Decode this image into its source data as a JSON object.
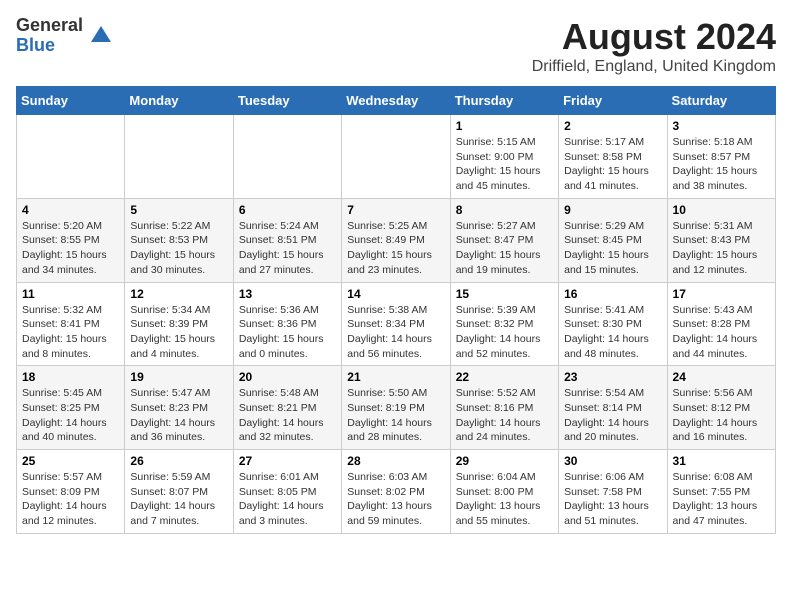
{
  "logo": {
    "general": "General",
    "blue": "Blue"
  },
  "title": {
    "month_year": "August 2024",
    "location": "Driffield, England, United Kingdom"
  },
  "weekdays": [
    "Sunday",
    "Monday",
    "Tuesday",
    "Wednesday",
    "Thursday",
    "Friday",
    "Saturday"
  ],
  "weeks": [
    [
      {
        "day": "",
        "content": ""
      },
      {
        "day": "",
        "content": ""
      },
      {
        "day": "",
        "content": ""
      },
      {
        "day": "",
        "content": ""
      },
      {
        "day": "1",
        "content": "Sunrise: 5:15 AM\nSunset: 9:00 PM\nDaylight: 15 hours\nand 45 minutes."
      },
      {
        "day": "2",
        "content": "Sunrise: 5:17 AM\nSunset: 8:58 PM\nDaylight: 15 hours\nand 41 minutes."
      },
      {
        "day": "3",
        "content": "Sunrise: 5:18 AM\nSunset: 8:57 PM\nDaylight: 15 hours\nand 38 minutes."
      }
    ],
    [
      {
        "day": "4",
        "content": "Sunrise: 5:20 AM\nSunset: 8:55 PM\nDaylight: 15 hours\nand 34 minutes."
      },
      {
        "day": "5",
        "content": "Sunrise: 5:22 AM\nSunset: 8:53 PM\nDaylight: 15 hours\nand 30 minutes."
      },
      {
        "day": "6",
        "content": "Sunrise: 5:24 AM\nSunset: 8:51 PM\nDaylight: 15 hours\nand 27 minutes."
      },
      {
        "day": "7",
        "content": "Sunrise: 5:25 AM\nSunset: 8:49 PM\nDaylight: 15 hours\nand 23 minutes."
      },
      {
        "day": "8",
        "content": "Sunrise: 5:27 AM\nSunset: 8:47 PM\nDaylight: 15 hours\nand 19 minutes."
      },
      {
        "day": "9",
        "content": "Sunrise: 5:29 AM\nSunset: 8:45 PM\nDaylight: 15 hours\nand 15 minutes."
      },
      {
        "day": "10",
        "content": "Sunrise: 5:31 AM\nSunset: 8:43 PM\nDaylight: 15 hours\nand 12 minutes."
      }
    ],
    [
      {
        "day": "11",
        "content": "Sunrise: 5:32 AM\nSunset: 8:41 PM\nDaylight: 15 hours\nand 8 minutes."
      },
      {
        "day": "12",
        "content": "Sunrise: 5:34 AM\nSunset: 8:39 PM\nDaylight: 15 hours\nand 4 minutes."
      },
      {
        "day": "13",
        "content": "Sunrise: 5:36 AM\nSunset: 8:36 PM\nDaylight: 15 hours\nand 0 minutes."
      },
      {
        "day": "14",
        "content": "Sunrise: 5:38 AM\nSunset: 8:34 PM\nDaylight: 14 hours\nand 56 minutes."
      },
      {
        "day": "15",
        "content": "Sunrise: 5:39 AM\nSunset: 8:32 PM\nDaylight: 14 hours\nand 52 minutes."
      },
      {
        "day": "16",
        "content": "Sunrise: 5:41 AM\nSunset: 8:30 PM\nDaylight: 14 hours\nand 48 minutes."
      },
      {
        "day": "17",
        "content": "Sunrise: 5:43 AM\nSunset: 8:28 PM\nDaylight: 14 hours\nand 44 minutes."
      }
    ],
    [
      {
        "day": "18",
        "content": "Sunrise: 5:45 AM\nSunset: 8:25 PM\nDaylight: 14 hours\nand 40 minutes."
      },
      {
        "day": "19",
        "content": "Sunrise: 5:47 AM\nSunset: 8:23 PM\nDaylight: 14 hours\nand 36 minutes."
      },
      {
        "day": "20",
        "content": "Sunrise: 5:48 AM\nSunset: 8:21 PM\nDaylight: 14 hours\nand 32 minutes."
      },
      {
        "day": "21",
        "content": "Sunrise: 5:50 AM\nSunset: 8:19 PM\nDaylight: 14 hours\nand 28 minutes."
      },
      {
        "day": "22",
        "content": "Sunrise: 5:52 AM\nSunset: 8:16 PM\nDaylight: 14 hours\nand 24 minutes."
      },
      {
        "day": "23",
        "content": "Sunrise: 5:54 AM\nSunset: 8:14 PM\nDaylight: 14 hours\nand 20 minutes."
      },
      {
        "day": "24",
        "content": "Sunrise: 5:56 AM\nSunset: 8:12 PM\nDaylight: 14 hours\nand 16 minutes."
      }
    ],
    [
      {
        "day": "25",
        "content": "Sunrise: 5:57 AM\nSunset: 8:09 PM\nDaylight: 14 hours\nand 12 minutes."
      },
      {
        "day": "26",
        "content": "Sunrise: 5:59 AM\nSunset: 8:07 PM\nDaylight: 14 hours\nand 7 minutes."
      },
      {
        "day": "27",
        "content": "Sunrise: 6:01 AM\nSunset: 8:05 PM\nDaylight: 14 hours\nand 3 minutes."
      },
      {
        "day": "28",
        "content": "Sunrise: 6:03 AM\nSunset: 8:02 PM\nDaylight: 13 hours\nand 59 minutes."
      },
      {
        "day": "29",
        "content": "Sunrise: 6:04 AM\nSunset: 8:00 PM\nDaylight: 13 hours\nand 55 minutes."
      },
      {
        "day": "30",
        "content": "Sunrise: 6:06 AM\nSunset: 7:58 PM\nDaylight: 13 hours\nand 51 minutes."
      },
      {
        "day": "31",
        "content": "Sunrise: 6:08 AM\nSunset: 7:55 PM\nDaylight: 13 hours\nand 47 minutes."
      }
    ]
  ]
}
